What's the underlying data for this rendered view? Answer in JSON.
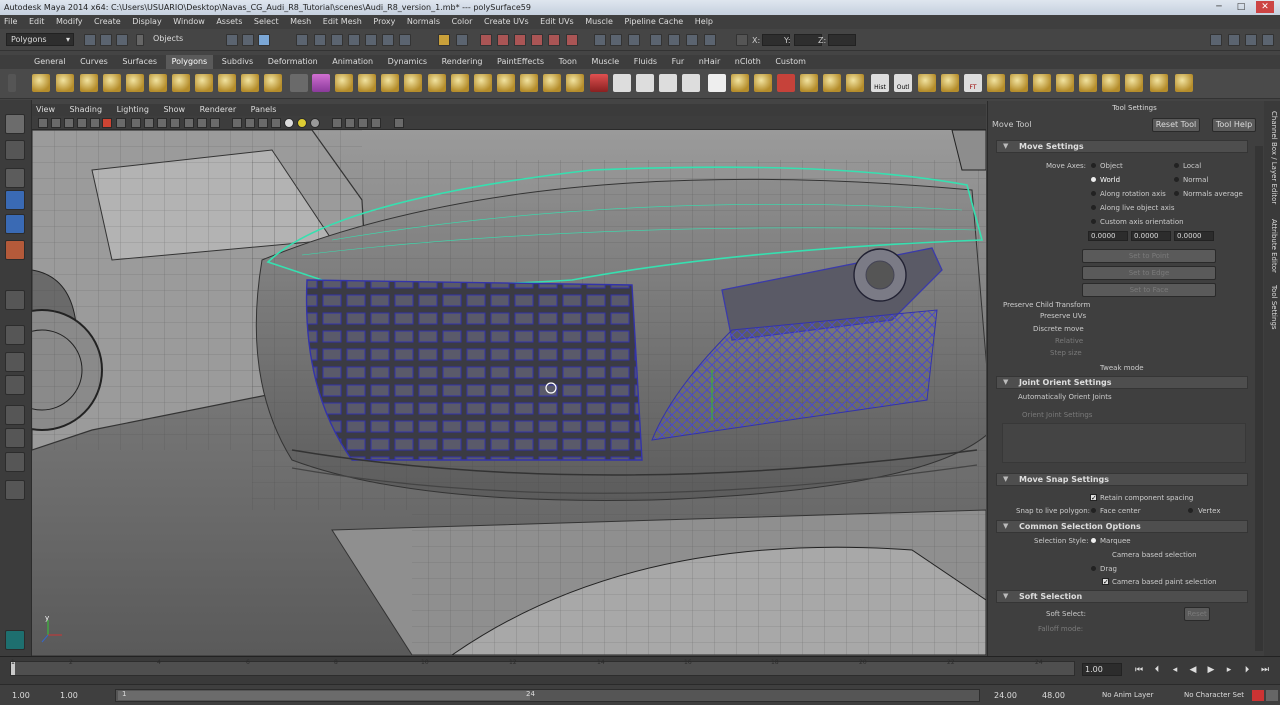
{
  "window": {
    "title": "Autodesk Maya 2014 x64: C:\\Users\\USUARIO\\Desktop\\Navas_CG_Audi_R8_Tutorial\\scenes\\Audi_R8_version_1.mb* --- polySurface59",
    "minimize": "─",
    "maximize": "□",
    "close": "✕"
  },
  "menu": [
    "File",
    "Edit",
    "Modify",
    "Create",
    "Display",
    "Window",
    "Assets",
    "Select",
    "Mesh",
    "Edit Mesh",
    "Proxy",
    "Normals",
    "Color",
    "Create UVs",
    "Edit UVs",
    "Muscle",
    "Pipeline Cache",
    "Help"
  ],
  "status": {
    "mode": "Polygons",
    "selection_mask": "Objects",
    "x_label": "X:",
    "y_label": "Y:",
    "z_label": "Z:"
  },
  "shelf": {
    "tabs": [
      "General",
      "Curves",
      "Surfaces",
      "Polygons",
      "Subdivs",
      "Deformation",
      "Animation",
      "Dynamics",
      "Rendering",
      "PaintEffects",
      "Toon",
      "Muscle",
      "Fluids",
      "Fur",
      "nHair",
      "nCloth",
      "Custom"
    ],
    "active_tab": "Polygons",
    "icon_labels": [
      "Hist",
      "Outl",
      "FT"
    ]
  },
  "viewport": {
    "menu": [
      "View",
      "Shading",
      "Lighting",
      "Show",
      "Renderer",
      "Panels"
    ],
    "axis_label": "y"
  },
  "tool_settings": {
    "header": "Tool Settings",
    "tool_name": "Move Tool",
    "reset_button": "Reset Tool",
    "help_button": "Tool Help",
    "move_settings": {
      "title": "Move Settings",
      "move_axes_label": "Move Axes:",
      "options": [
        "Object",
        "Local",
        "World",
        "Normal",
        "Along rotation axis",
        "Normals average",
        "Along live object axis",
        "Custom axis orientation"
      ],
      "selected": "World",
      "x": "0.0000",
      "y": "0.0000",
      "z": "0.0000",
      "set_to_point": "Set to Point",
      "set_to_edge": "Set to Edge",
      "set_to_face": "Set to Face",
      "preserve_child": "Preserve Child Transform",
      "preserve_uvs": "Preserve UVs",
      "discrete_move": "Discrete move",
      "relative": "Relative",
      "step_size": "Step size",
      "tweak_mode": "Tweak mode"
    },
    "joint_orient": {
      "title": "Joint Orient Settings",
      "auto_orient": "Automatically Orient Joints",
      "orient_joint": "Orient Joint Settings"
    },
    "move_snap": {
      "title": "Move Snap Settings",
      "retain_spacing": "Retain component spacing",
      "snap_label": "Snap to live polygon:",
      "face_center": "Face center",
      "vertex": "Vertex"
    },
    "common_selection": {
      "title": "Common Selection Options",
      "style_label": "Selection Style:",
      "marquee": "Marquee",
      "camera_sel": "Camera based selection",
      "drag": "Drag",
      "camera_paint": "Camera based paint selection"
    },
    "soft_selection": {
      "title": "Soft Selection",
      "soft_select": "Soft Select:",
      "reset": "Reset",
      "falloff": "Falloff mode:"
    }
  },
  "right_tabs": [
    "Channel Box / Layer Editor",
    "Attribute Editor",
    "Tool Settings"
  ],
  "timeline": {
    "ticks": [
      "1",
      "2",
      "4",
      "6",
      "8",
      "10",
      "12",
      "14",
      "16",
      "18",
      "20",
      "22",
      "24"
    ],
    "current_frame": "1.00"
  },
  "range": {
    "start": "1.00",
    "anim_start": "1.00",
    "range_start_marker": "1",
    "range_end_marker": "24",
    "anim_end": "24.00",
    "end": "48.00",
    "anim_layer": "No Anim Layer",
    "character_set": "No Character Set"
  }
}
